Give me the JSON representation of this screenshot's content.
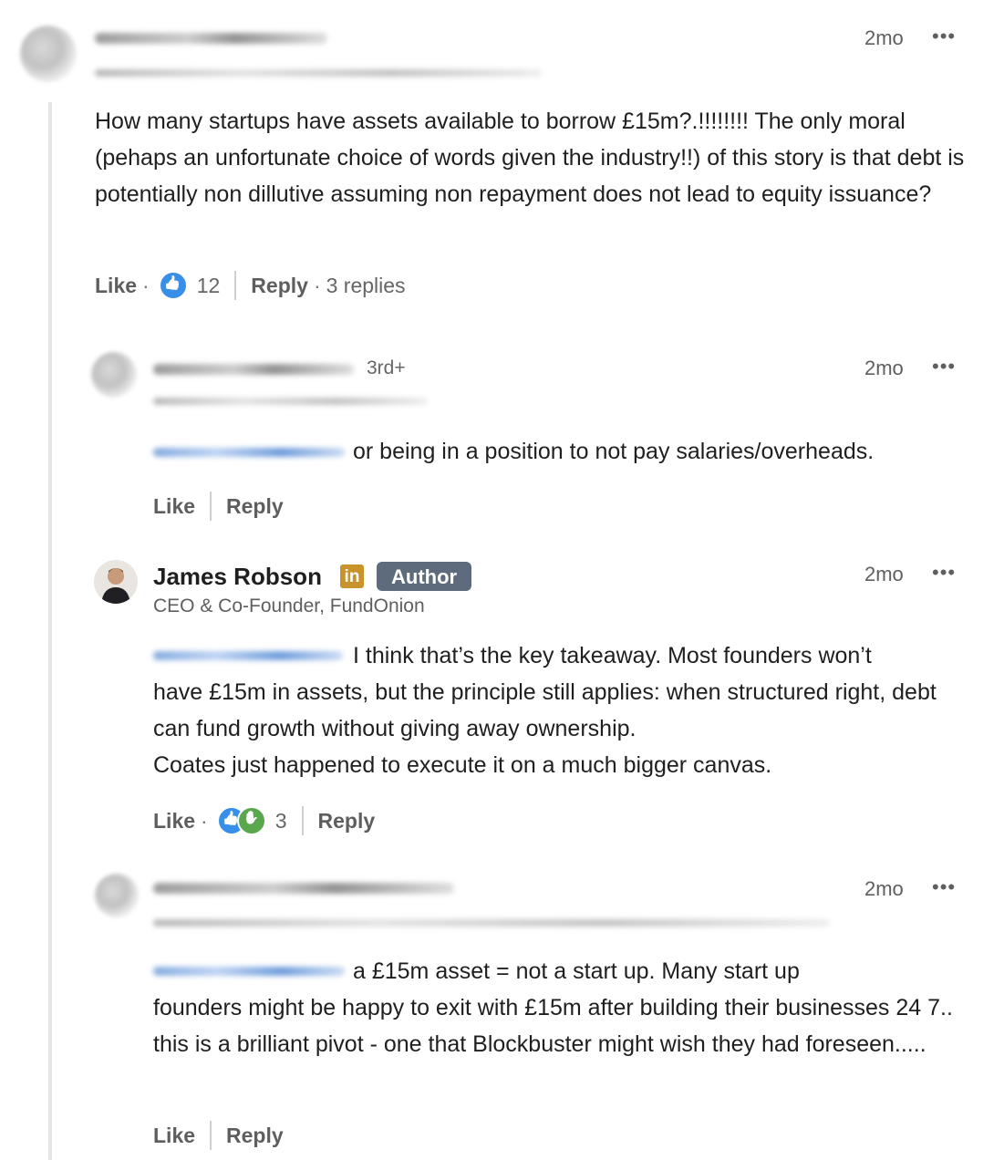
{
  "comments": [
    {
      "time": "2mo",
      "more": "•••",
      "text": "How many startups have assets available to borrow £15m?.!!!!!!!! The only moral (pehaps an unfortunate choice of words given the industry!!) of this story is that debt is potentially non dillutive assuming non repayment does not lead to equity issuance?",
      "like_label": "Like",
      "reaction_count": "12",
      "reply_label": "Reply",
      "replies_count": "3 replies"
    }
  ],
  "replies": [
    {
      "degree": "3rd+",
      "time": "2mo",
      "more": "•••",
      "text": "or being in a position to not pay salaries/overheads.",
      "like_label": "Like",
      "reply_label": "Reply"
    },
    {
      "name": "James Robson",
      "in_badge": "in",
      "author_tag": "Author",
      "headline": "CEO & Co-Founder, FundOnion",
      "time": "2mo",
      "more": "•••",
      "text_line1": "I think that’s the key takeaway. Most founders won’t",
      "text_rest": "have £15m in assets, but the principle still applies: when structured right, debt can fund growth without giving away ownership.",
      "text_line4": "Coates just happened to execute it on a much bigger canvas.",
      "like_label": "Like",
      "reaction_count": "3",
      "reply_label": "Reply"
    },
    {
      "time": "2mo",
      "more": "•••",
      "text_line1": "a £15m asset = not a start up. Many start up",
      "text_rest": "founders might be happy to exit with £15m after building their businesses 24 7.. this is a brilliant pivot - one that Blockbuster might wish they had foreseen.....",
      "like_label": "Like",
      "reply_label": "Reply"
    }
  ]
}
